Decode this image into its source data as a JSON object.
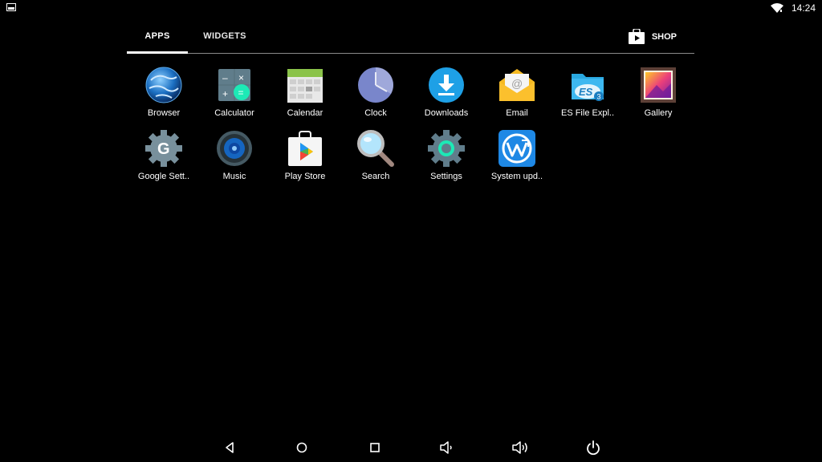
{
  "status_bar": {
    "time": "14:24",
    "icons": [
      "screenshot-icon",
      "wifi-icon"
    ]
  },
  "tabs": [
    {
      "label": "APPS",
      "selected": true
    },
    {
      "label": "WIDGETS",
      "selected": false
    }
  ],
  "shop": {
    "label": "SHOP",
    "icon": "play-store-bag-icon"
  },
  "apps": [
    {
      "label": "Browser",
      "icon": "browser-globe-icon"
    },
    {
      "label": "Calculator",
      "icon": "calculator-icon"
    },
    {
      "label": "Calendar",
      "icon": "calendar-icon"
    },
    {
      "label": "Clock",
      "icon": "clock-icon"
    },
    {
      "label": "Downloads",
      "icon": "downloads-icon"
    },
    {
      "label": "Email",
      "icon": "email-icon"
    },
    {
      "label": "ES File Expl..",
      "icon": "es-file-explorer-icon"
    },
    {
      "label": "Gallery",
      "icon": "gallery-icon"
    },
    {
      "label": "Google Sett..",
      "icon": "google-settings-icon"
    },
    {
      "label": "Music",
      "icon": "music-speaker-icon"
    },
    {
      "label": "Play Store",
      "icon": "play-store-icon"
    },
    {
      "label": "Search",
      "icon": "search-magnifier-icon"
    },
    {
      "label": "Settings",
      "icon": "settings-gear-icon"
    },
    {
      "label": "System upd..",
      "icon": "system-update-icon"
    }
  ],
  "nav_bar": [
    "back-icon",
    "home-icon",
    "recents-icon",
    "volume-down-icon",
    "volume-up-icon",
    "power-icon"
  ],
  "colors": {
    "background": "#000000",
    "tab_underline": "#ffffff",
    "divider": "#8a8a8a",
    "downloads_blue": "#1ea0e6",
    "email_yellow": "#f5b921"
  }
}
